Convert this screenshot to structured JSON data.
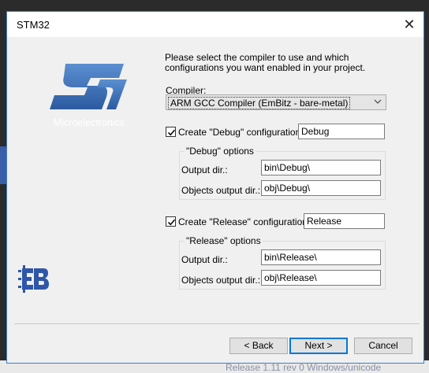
{
  "window": {
    "title": "STM32",
    "close_glyph": "✕"
  },
  "logo": {
    "caption": "Microelectronics",
    "brand_color": "#3b6fb6"
  },
  "intro_text": "Please select the compiler to use and which configurations you want enabled in your project.",
  "compiler": {
    "label": "Compiler:",
    "selected": "ARM GCC Compiler (EmBitz - bare-metal)"
  },
  "debug": {
    "checked": true,
    "create_label": "Create \"Debug\" configuration:",
    "name": "Debug",
    "group_title": "\"Debug\" options",
    "output_label": "Output dir.:",
    "output_value": "bin\\Debug\\",
    "objects_label": "Objects output dir.:",
    "objects_value": "obj\\Debug\\"
  },
  "release": {
    "checked": true,
    "create_label": "Create \"Release\" configuration:",
    "name": "Release",
    "group_title": "\"Release\" options",
    "output_label": "Output dir.:",
    "output_value": "bin\\Release\\",
    "objects_label": "Objects output dir.:",
    "objects_value": "obj\\Release\\"
  },
  "buttons": {
    "back": "< Back",
    "next": "Next >",
    "cancel": "Cancel"
  },
  "background_text": "Release 1.11 rev 0 Windows/unicode"
}
